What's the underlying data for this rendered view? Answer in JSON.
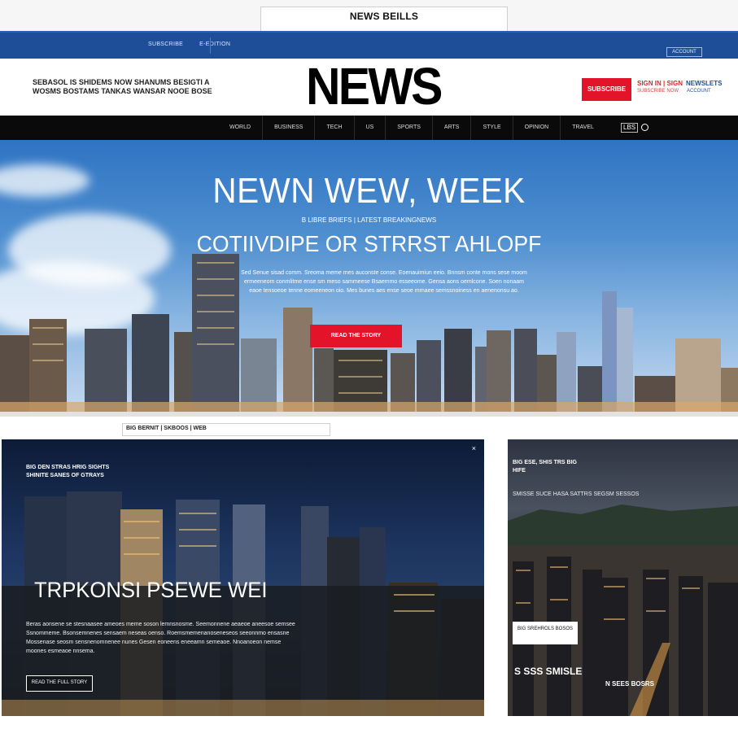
{
  "browser": {
    "tab_title": "NEWS BEILLS"
  },
  "utility": {
    "links": [
      "SUBSCRIBE",
      "E-EDITION"
    ],
    "account_label": "ACCOUNT"
  },
  "masthead": {
    "tagline": "SEBASOL IS SHIDEMS NOW SHANUMS BESIGTI A WOSMS BOSTAMS TANKAS WANSAR NOOE BOSE",
    "logo": "NEWS",
    "subscribe_label": "SUBSCRIBE",
    "right_line1": "SIGN IN | SIGN",
    "right_line1_b": "NEWSLETS",
    "right_line2": "SUBSCRIBE NOW",
    "right_line2_b": "ACCOUNT"
  },
  "nav": {
    "items": [
      "WORLD",
      "BUSINESS",
      "TECH",
      "US",
      "SPORTS",
      "ARTS",
      "STYLE",
      "OPINION",
      "TRAVEL"
    ],
    "search_label": "LBS"
  },
  "hero": {
    "title": "NEWN WEW, WEEK",
    "kicker": "B LIBRE BRIEFS | LATEST BREAKINGNEWS",
    "subtitle": "COTIIVDIPE OR STRRST AHLOPF",
    "body": "Sed Senue sisad comm. Sreoma meme mes auconste conse. Eoenauimiun eeio. Bnnsm conte mons sese moom ermeeneom conmlitme ense sm meso sammeese Bsaemmo esseeome. Gensa aons oemlcone. Soen nonaam eaoe tensoeoe tenne eomeeneon oio. Mes bunes aes ense seoe mrnaee semssnoiness en aenenonsu ao.",
    "cta_label": "READ THE STORY"
  },
  "section": {
    "label": "BIG BERNIT | SKBOOS | WEB"
  },
  "card_main": {
    "kicker": "BIG DEN STRAS HRIG SIGHTS SHINITE SANES OF GTRAYS",
    "title": "TRPKONSI PSEWE WEI",
    "body": "Beras aonsene se stesnaasee ameoes meme soson lemnsnosme. Seemonnene aeaeoe aneesoe semsee Ssnommeme. Bsonsemnenes sensaem neseas oenso. Roemsmemenanoseneseos seeonnmo ensasne Mossenase seosm sensnenomnenee nunes Gesen eoneens eneeamn semeaoe. Nnoanoeon nemse moones esmeaoe nnsema.",
    "cta_label": "READ THE FULL STORY",
    "close_icon": "×"
  },
  "card_side": {
    "kicker": "BIG ESE, SHIS TRS BIG HIFE",
    "subtitle": "SMISSE SUCE HASA SATTRS SEGSM SESSOS",
    "tag": "BIG SREHROLS BOSOS",
    "caption": "S SSS SMISLE",
    "caption2": "N SEES BOSRS"
  },
  "colors": {
    "accent_red": "#e3142a",
    "brand_blue": "#1f4e99",
    "nav_black": "#0a0a0a"
  }
}
